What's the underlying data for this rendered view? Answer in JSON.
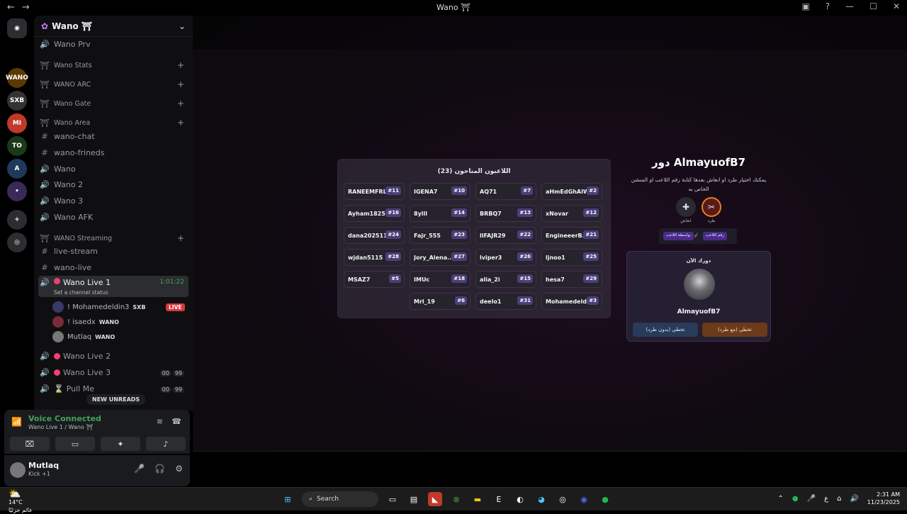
{
  "window": {
    "title": "Wano ⛩",
    "back": "←",
    "forward": "→",
    "inbox_icon": "inbox-icon",
    "help_icon": "?",
    "minimize": "—",
    "maximize": "☐",
    "close": "✕"
  },
  "guilds": [
    {
      "label": "",
      "color": "#2b2d31"
    },
    {
      "label": "WANO",
      "color": "#5b3a00"
    },
    {
      "label": "SXB",
      "color": "#333"
    },
    {
      "label": "MI",
      "color": "#c0392b"
    },
    {
      "label": "TO",
      "color": "#1a3a1a"
    },
    {
      "label": "A",
      "color": "#1e3a5a"
    },
    {
      "label": "•",
      "color": "#3a2a5a"
    },
    {
      "label": "+",
      "color": "#2b2d31"
    },
    {
      "label": "◎",
      "color": "#2b2d31"
    }
  ],
  "server": {
    "name": "Wano ⛩",
    "icon": "server-icon"
  },
  "channels": {
    "wano_prv": "Wano Prv",
    "cat_stats": "Wano Stats",
    "cat_arc": "WANO ARC",
    "cat_gate": "Wano Gate",
    "cat_area": "Wano Area",
    "wano_chat": "wano-chat",
    "wano_frineds": "wano-frineds",
    "wano": "Wano",
    "wano2": "Wano 2",
    "wano3": "Wano 3",
    "wano_afk": "Wano AFK",
    "cat_streaming": "WANO Streaming",
    "live_stream": "live-stream",
    "wano_live": "wano-live",
    "live1": "Wano Live 1",
    "live1_time": "1:01:22",
    "live1_status": "Set a channel status",
    "live2": "Wano Live 2",
    "live3": "Wano Live 3",
    "pull_me": "Pull Me",
    "badge_00": "00",
    "badge_99": "99",
    "new_unreads": "NEW UNREADS"
  },
  "voice_users": [
    {
      "name": "! Mohamedeldin3",
      "tag": "SXB",
      "live": "LIVE"
    },
    {
      "name": "! isaedx",
      "tag": "WANO"
    },
    {
      "name": "Mutlaq",
      "tag": "WANO"
    }
  ],
  "voice": {
    "title": "Voice Connected",
    "sub": "Wano Live 1 / Wano ⛩"
  },
  "panel": {
    "name": "Mutlaq",
    "status": "Kick +1"
  },
  "grid": {
    "title": "اللاعبون المتاحون (23)",
    "cells": [
      [
        "RANEEMFRL",
        "#11"
      ],
      [
        "IGENA7",
        "#10"
      ],
      [
        "AQ71",
        "#7"
      ],
      [
        "aHmEdGhAIW...",
        "#2"
      ],
      [
        "Ayham1825",
        "#16"
      ],
      [
        "8ylll",
        "#14"
      ],
      [
        "BRBQ7",
        "#13"
      ],
      [
        "xNovar",
        "#12"
      ],
      [
        "dana202511",
        "#24"
      ],
      [
        "Fajr_555",
        "#23"
      ],
      [
        "llFAJR29",
        "#22"
      ],
      [
        "EngineeerB...",
        "#21"
      ],
      [
        "wjdan5115",
        "#28"
      ],
      [
        "Jory_Alena...",
        "#27"
      ],
      [
        "lviper3",
        "#26"
      ],
      [
        "ljnoo1",
        "#25"
      ],
      [
        "MSAZ7",
        "#5"
      ],
      [
        "IMUc",
        "#18"
      ],
      [
        "alia_2i",
        "#15"
      ],
      [
        "hesa7",
        "#29"
      ],
      [
        "",
        ""
      ],
      [
        "Mrl_19",
        "#6"
      ],
      [
        "deelo1",
        "#31"
      ],
      [
        "Mohamedeld...",
        "#3"
      ]
    ]
  },
  "role": {
    "title": "دور AlmayuofB7",
    "desc": "يمكنك اختيار طرد او انعاش بعدها كتابة رقم اللاعب او المنشن الخاص به",
    "kick_label": "طرد",
    "revive_label": "انعاش",
    "chip_mention": "بواسطة اللاعب",
    "chip_or": "او",
    "chip_number": "رقم اللاعب",
    "turn_label": "دورك الآن",
    "player": "AlmayuofB7",
    "skip_no_kick": "تخطي (بدون طرد)",
    "skip_with_kick": "تخطي (مع طرد)"
  },
  "taskbar": {
    "temp": "14°C",
    "weather_text": "غائم جزئيًا",
    "search": "Search",
    "time": "2:31 AM",
    "date": "11/23/2025",
    "lang": "ع"
  }
}
